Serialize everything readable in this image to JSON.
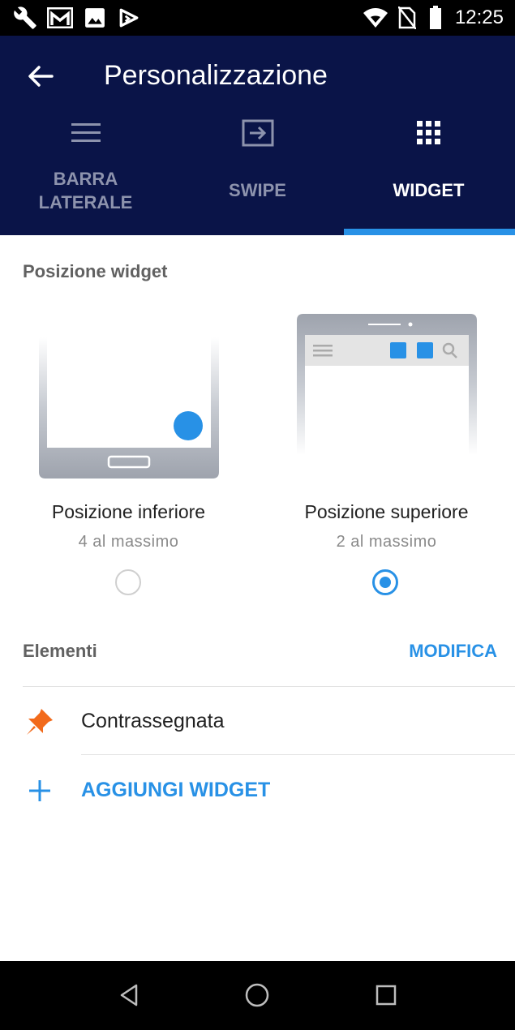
{
  "status_bar": {
    "time": "12:25"
  },
  "app_bar": {
    "title": "Personalizzazione"
  },
  "tabs": [
    {
      "label": "BARRA\nLATERALE",
      "icon": "menu-icon"
    },
    {
      "label": "SWIPE",
      "icon": "swipe-icon"
    },
    {
      "label": "WIDGET",
      "icon": "grid-icon"
    }
  ],
  "section": {
    "title": "Posizione widget"
  },
  "positions": [
    {
      "name": "Posizione inferiore",
      "subtitle": "4 al massimo",
      "selected": false
    },
    {
      "name": "Posizione superiore",
      "subtitle": "2 al massimo",
      "selected": true
    }
  ],
  "elements": {
    "title": "Elementi",
    "edit_label": "MODIFICA",
    "items": [
      {
        "label": "Contrassegnata",
        "icon": "pin-icon"
      }
    ],
    "add_label": "AGGIUNGI WIDGET"
  },
  "colors": {
    "app_bar": "#0a1448",
    "accent": "#2891e6",
    "pin": "#f26a1b",
    "device_gray": "#9ea3ad"
  }
}
